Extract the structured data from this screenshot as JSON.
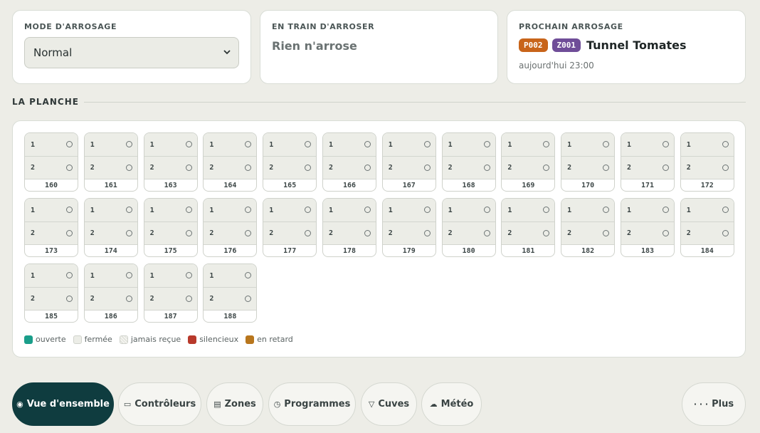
{
  "mode": {
    "label": "MODE D'ARROSAGE",
    "selected": "Normal",
    "icon": "chevron-down-icon"
  },
  "running": {
    "label": "EN TRAIN D'ARROSER",
    "text": "Rien n'arrose"
  },
  "next": {
    "label": "PROCHAIN ARROSAGE",
    "program_badge": "P002",
    "zone_badge": "Z001",
    "name": "Tunnel Tomates",
    "time": "aujourd'hui 23:00"
  },
  "section": {
    "title": "LA PLANCHE"
  },
  "controllers": [
    {
      "id": "160",
      "slots": [
        "1",
        "2"
      ]
    },
    {
      "id": "161",
      "slots": [
        "1",
        "2"
      ]
    },
    {
      "id": "163",
      "slots": [
        "1",
        "2"
      ]
    },
    {
      "id": "164",
      "slots": [
        "1",
        "2"
      ]
    },
    {
      "id": "165",
      "slots": [
        "1",
        "2"
      ]
    },
    {
      "id": "166",
      "slots": [
        "1",
        "2"
      ]
    },
    {
      "id": "167",
      "slots": [
        "1",
        "2"
      ]
    },
    {
      "id": "168",
      "slots": [
        "1",
        "2"
      ]
    },
    {
      "id": "169",
      "slots": [
        "1",
        "2"
      ]
    },
    {
      "id": "170",
      "slots": [
        "1",
        "2"
      ]
    },
    {
      "id": "171",
      "slots": [
        "1",
        "2"
      ]
    },
    {
      "id": "172",
      "slots": [
        "1",
        "2"
      ]
    },
    {
      "id": "173",
      "slots": [
        "1",
        "2"
      ]
    },
    {
      "id": "174",
      "slots": [
        "1",
        "2"
      ]
    },
    {
      "id": "175",
      "slots": [
        "1",
        "2"
      ]
    },
    {
      "id": "176",
      "slots": [
        "1",
        "2"
      ]
    },
    {
      "id": "177",
      "slots": [
        "1",
        "2"
      ]
    },
    {
      "id": "178",
      "slots": [
        "1",
        "2"
      ]
    },
    {
      "id": "179",
      "slots": [
        "1",
        "2"
      ]
    },
    {
      "id": "180",
      "slots": [
        "1",
        "2"
      ]
    },
    {
      "id": "181",
      "slots": [
        "1",
        "2"
      ]
    },
    {
      "id": "182",
      "slots": [
        "1",
        "2"
      ]
    },
    {
      "id": "183",
      "slots": [
        "1",
        "2"
      ]
    },
    {
      "id": "184",
      "slots": [
        "1",
        "2"
      ]
    },
    {
      "id": "185",
      "slots": [
        "1",
        "2"
      ]
    },
    {
      "id": "186",
      "slots": [
        "1",
        "2"
      ]
    },
    {
      "id": "187",
      "slots": [
        "1",
        "2"
      ]
    },
    {
      "id": "188",
      "slots": [
        "1",
        "2"
      ]
    }
  ],
  "legend": [
    {
      "key": "open",
      "label": "ouverte",
      "color": "#1a9e8a"
    },
    {
      "key": "closed",
      "label": "fermée",
      "color": "#ecede7"
    },
    {
      "key": "never",
      "label": "jamais reçue",
      "color": "#d9dbd4"
    },
    {
      "key": "silent",
      "label": "silencieux",
      "color": "#b8392b"
    },
    {
      "key": "late",
      "label": "en retard",
      "color": "#b8761d"
    }
  ],
  "nav": {
    "items": [
      {
        "label": "Vue d'ensemble",
        "icon": "◉",
        "icon_name": "overview-icon",
        "active": true
      },
      {
        "label": "Contrôleurs",
        "icon": "▭",
        "icon_name": "controller-icon",
        "active": false
      },
      {
        "label": "Zones",
        "icon": "▤",
        "icon_name": "zones-icon",
        "active": false
      },
      {
        "label": "Programmes",
        "icon": "◷",
        "icon_name": "clock-icon",
        "active": false
      },
      {
        "label": "Cuves",
        "icon": "▽",
        "icon_name": "tank-icon",
        "active": false
      },
      {
        "label": "Météo",
        "icon": "☁",
        "icon_name": "weather-icon",
        "active": false
      }
    ],
    "more": {
      "label": "Plus",
      "icon": "· · ·",
      "icon_name": "more-icon"
    }
  },
  "colors": {
    "accent": "#0f3c3f",
    "background": "#edede7",
    "program_badge": "#c8641a",
    "zone_badge": "#6f4d98"
  }
}
